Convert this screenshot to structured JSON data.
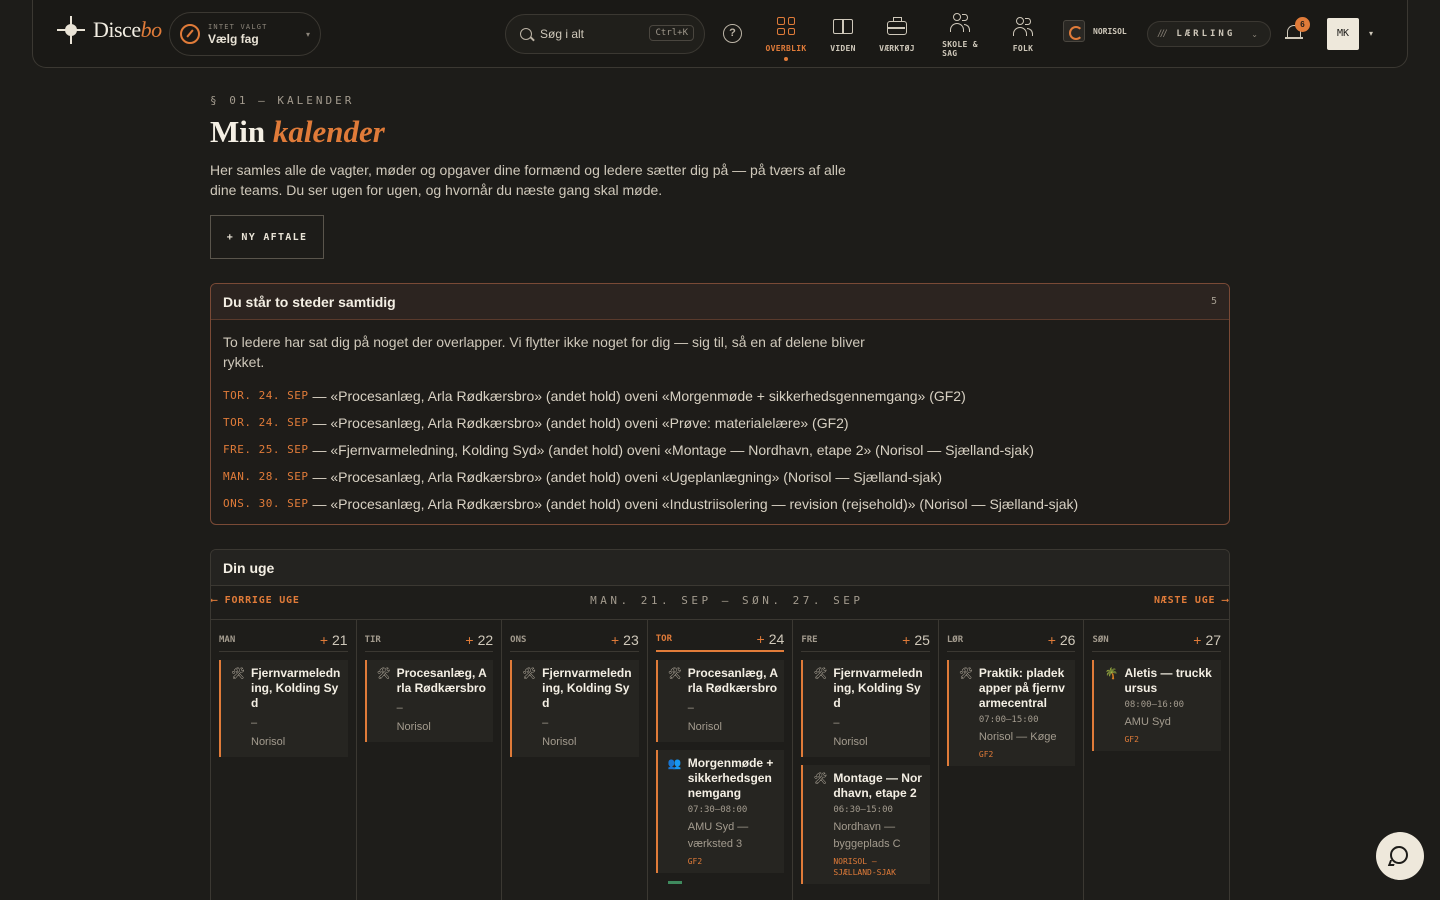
{
  "brand": {
    "name_a": "Disce",
    "name_b": "bo"
  },
  "subject_picker": {
    "eyebrow": "INTET VALGT",
    "label": "Vælg fag"
  },
  "search": {
    "placeholder": "Søg i alt",
    "shortcut": "Ctrl+K"
  },
  "nav": [
    {
      "label": "OVERBLIK",
      "active": true
    },
    {
      "label": "VIDEN"
    },
    {
      "label": "VÆRKTØJ"
    },
    {
      "label": "SKOLE &",
      "label2": "SAG"
    },
    {
      "label": "FOLK"
    }
  ],
  "org": {
    "name": "NORISOL"
  },
  "role": {
    "label": "LÆRLING"
  },
  "notifications": {
    "count": "6"
  },
  "user": {
    "initials": "MK"
  },
  "page": {
    "eyebrow": "§ 01 — KALENDER",
    "title_a": "Min",
    "title_b": "kalender",
    "intro": "Her samles alle de vagter, møder og opgaver dine formænd og ledere sætter dig på — på tværs af alle dine teams. Du ser ugen for ugen, og hvornår du næste gang skal møde.",
    "new_button": "+ NY AFTALE"
  },
  "conflicts": {
    "title": "Du står to steder samtidig",
    "count": "5",
    "description": "To ledere har sat dig på noget der overlapper. Vi flytter ikke noget for dig — sig til, så en af delene bliver rykket.",
    "items": [
      {
        "date": "TOR. 24. SEP",
        "text": "— «Procesanlæg, Arla Rødkærsbro» (andet hold) oveni «Morgenmøde + sikkerhedsgennemgang» (GF2)"
      },
      {
        "date": "TOR. 24. SEP",
        "text": "— «Procesanlæg, Arla Rødkærsbro» (andet hold) oveni «Prøve: materialelære» (GF2)"
      },
      {
        "date": "FRE. 25. SEP",
        "text": "— «Fjernvarmeledning, Kolding Syd» (andet hold) oveni «Montage — Nordhavn, etape 2» (Norisol — Sjælland-sjak)"
      },
      {
        "date": "MAN. 28. SEP",
        "text": "— «Procesanlæg, Arla Rødkærsbro» (andet hold) oveni «Ugeplanlægning» (Norisol — Sjælland-sjak)"
      },
      {
        "date": "ONS. 30. SEP",
        "text": "— «Procesanlæg, Arla Rødkærsbro» (andet hold) oveni «Industriisolering — revision (rejsehold)» (Norisol — Sjælland-sjak)"
      }
    ]
  },
  "week": {
    "title": "Din uge",
    "prev": "⟵ FORRIGE UGE",
    "range": "MAN. 21. SEP – SØN. 27. SEP",
    "next": "NÆSTE UGE ⟶",
    "days": [
      {
        "name": "MAN",
        "date": "21",
        "events": [
          {
            "icon": "tools-icon",
            "title": "Fjernvarmeledning, Kolding Syd",
            "time": "",
            "loc": "–",
            "loc2": "Norisol",
            "team": ""
          }
        ]
      },
      {
        "name": "TIR",
        "date": "22",
        "events": [
          {
            "icon": "tools-icon",
            "title": "Procesanlæg, Arla Rødkærsbro",
            "time": "",
            "loc": "–",
            "loc2": "Norisol",
            "team": ""
          }
        ]
      },
      {
        "name": "ONS",
        "date": "23",
        "events": [
          {
            "icon": "tools-icon",
            "title": "Fjernvarmeledning, Kolding Syd",
            "time": "",
            "loc": "–",
            "loc2": "Norisol",
            "team": ""
          }
        ]
      },
      {
        "name": "TOR",
        "date": "24",
        "today": true,
        "events": [
          {
            "icon": "tools-icon",
            "title": "Procesanlæg, Arla Rødkærsbro",
            "time": "",
            "loc": "–",
            "loc2": "Norisol",
            "team": ""
          },
          {
            "icon": "meeting-icon",
            "title": "Morgenmøde + sikkerhedsgennemgang",
            "time": "07:30–08:00",
            "loc": "AMU Syd — værksted 3",
            "loc2": "",
            "team": "GF2"
          }
        ]
      },
      {
        "name": "FRE",
        "date": "25",
        "events": [
          {
            "icon": "tools-icon",
            "title": "Fjernvarmeledning, Kolding Syd",
            "time": "",
            "loc": "–",
            "loc2": "Norisol",
            "team": ""
          },
          {
            "icon": "tools-icon",
            "title": "Montage — Nordhavn, etape 2",
            "time": "06:30–15:00",
            "loc": "Nordhavn — byggeplads C",
            "loc2": "",
            "team": "NORISOL — SJÆLLAND-SJAK"
          }
        ]
      },
      {
        "name": "LØR",
        "date": "26",
        "events": [
          {
            "icon": "tools-icon",
            "title": "Praktik: pladekapper på fjernvarmecentral",
            "time": "07:00–15:00",
            "loc": "Norisol — Køge",
            "loc2": "",
            "team": "GF2"
          }
        ]
      },
      {
        "name": "SØN",
        "date": "27",
        "events": [
          {
            "icon": "palm-icon",
            "title": "Aletis — truckkursus",
            "time": "08:00–16:00",
            "loc": "AMU Syd",
            "loc2": "",
            "team": "GF2"
          }
        ]
      }
    ]
  },
  "colors": {
    "accent": "#e07b39",
    "bg": "#1d1c19",
    "conflict_border": "#7a4a36"
  }
}
